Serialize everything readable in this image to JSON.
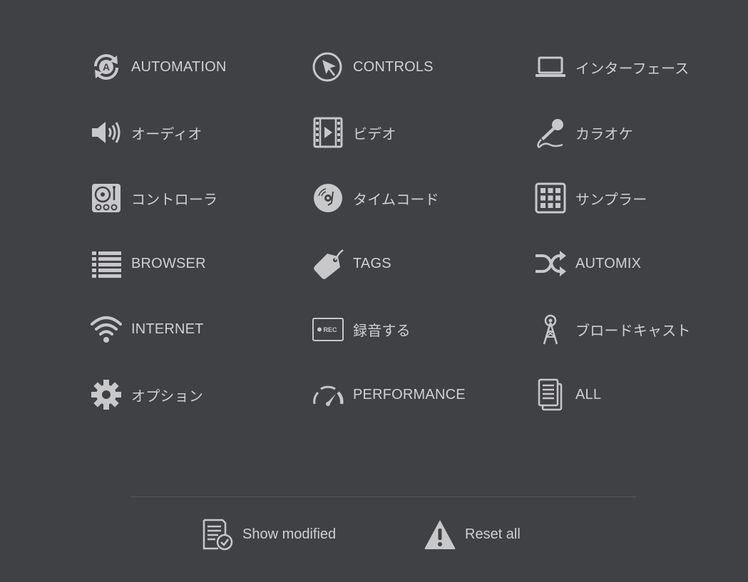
{
  "categories": {
    "automation": "AUTOMATION",
    "controls": "CONTROLS",
    "interface": "インターフェース",
    "audio": "オーディオ",
    "video": "ビデオ",
    "karaoke": "カラオケ",
    "controller": "コントローラ",
    "timecode": "タイムコード",
    "sampler": "サンプラー",
    "browser": "BROWSER",
    "tags": "TAGS",
    "automix": "AUTOMIX",
    "internet": "INTERNET",
    "record": "録音する",
    "broadcast": "ブロードキャスト",
    "options": "オプション",
    "performance": "PERFORMANCE",
    "all": "ALL"
  },
  "actions": {
    "show_modified": "Show modified",
    "reset_all": "Reset all"
  },
  "icons": {
    "automation": "automation-icon",
    "controls": "cursor-icon",
    "interface": "laptop-icon",
    "audio": "speaker-icon",
    "video": "film-icon",
    "karaoke": "microphone-icon",
    "controller": "turntable-icon",
    "timecode": "vinyl-icon",
    "sampler": "pad-grid-icon",
    "browser": "list-icon",
    "tags": "tag-icon",
    "automix": "shuffle-icon",
    "internet": "wifi-icon",
    "record": "rec-icon",
    "broadcast": "antenna-icon",
    "options": "gear-icon",
    "performance": "gauge-icon",
    "all": "documents-icon",
    "show_modified": "document-check-icon",
    "reset_all": "warning-icon"
  },
  "colors": {
    "background": "#404145",
    "icon": "#c8c8ca",
    "text": "#d0d0d2",
    "divider": "#5a5b5f"
  }
}
